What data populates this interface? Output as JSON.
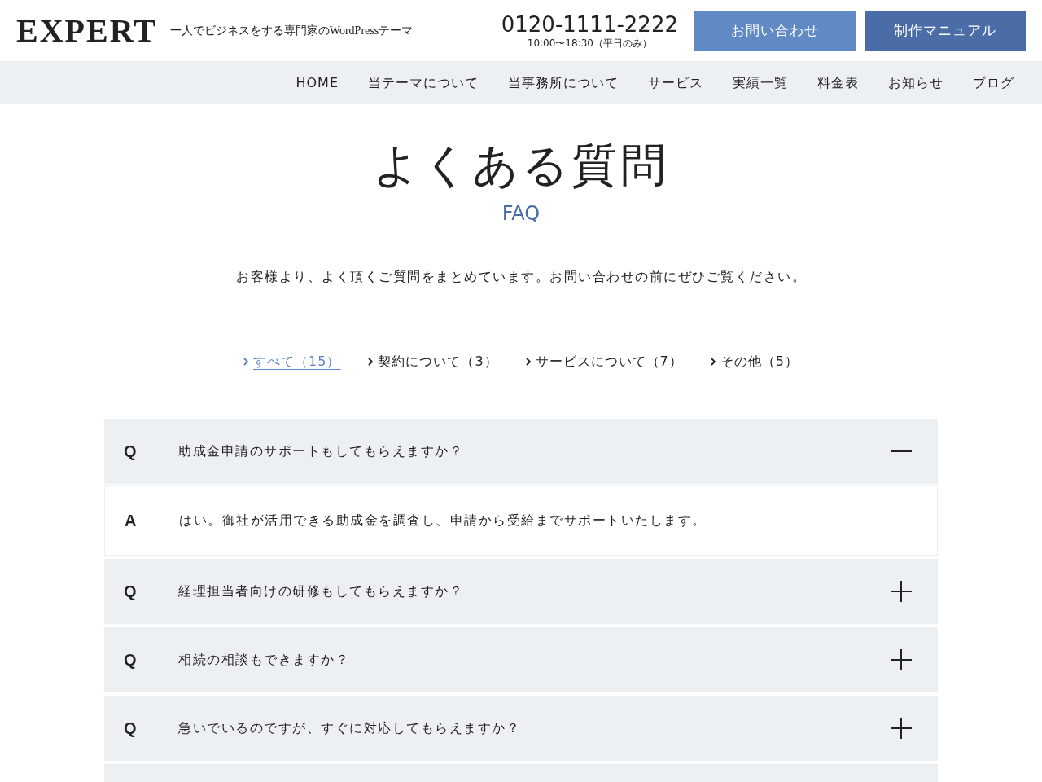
{
  "header": {
    "logo": "EXPERT",
    "tagline": "一人でビジネスをする専門家のWordPressテーマ",
    "phone": "0120-1111-2222",
    "hours": "10:00〜18:30（平日のみ）",
    "buttons": [
      {
        "label": "お問い合わせ",
        "kind": "light"
      },
      {
        "label": "制作マニュアル",
        "kind": "dark"
      }
    ]
  },
  "nav": [
    {
      "label": "HOME"
    },
    {
      "label": "当テーマについて"
    },
    {
      "label": "当事務所について"
    },
    {
      "label": "サービス"
    },
    {
      "label": "実績一覧"
    },
    {
      "label": "料金表"
    },
    {
      "label": "お知らせ"
    },
    {
      "label": "ブログ"
    }
  ],
  "hero": {
    "title": "よくある質問",
    "subtitle": "FAQ",
    "intro": "お客様より、よく頂くご質問をまとめています。お問い合わせの前にぜひご覧ください。"
  },
  "filters": [
    {
      "label": "すべて（15）",
      "selected": true
    },
    {
      "label": "契約について（3）",
      "selected": false
    },
    {
      "label": "サービスについて（7）",
      "selected": false
    },
    {
      "label": "その他（5）",
      "selected": false
    }
  ],
  "faq": [
    {
      "q_mark": "Q",
      "question": "助成金申請のサポートもしてもらえますか？",
      "expanded": true,
      "a_mark": "A",
      "answer": "はい。御社が活用できる助成金を調査し、申請から受給までサポートいたします。"
    },
    {
      "q_mark": "Q",
      "question": "経理担当者向けの研修もしてもらえますか？",
      "expanded": false
    },
    {
      "q_mark": "Q",
      "question": "相続の相談もできますか？",
      "expanded": false
    },
    {
      "q_mark": "Q",
      "question": "急いでいるのですが、すぐに対応してもらえますか？",
      "expanded": false
    }
  ]
}
